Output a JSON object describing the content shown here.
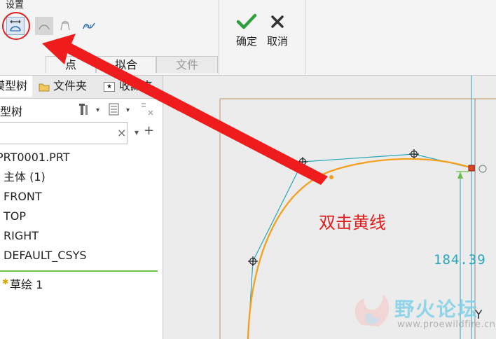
{
  "ribbon": {
    "settings_group_title": "设置",
    "ok_label": "确定",
    "cancel_label": "取消",
    "tabs": [
      {
        "label": "点",
        "active": true
      },
      {
        "label": "拟合",
        "active": true
      },
      {
        "label": "文件",
        "active": false
      }
    ]
  },
  "left_panel": {
    "nav_tabs": [
      "模型树",
      "文件夹",
      "收藏夹"
    ],
    "panel_title": "模型树",
    "search_placeholder": "",
    "search_clear": "×",
    "add_symbol": "+",
    "tree": {
      "root": "PRT0001.PRT",
      "items": [
        "主体 (1)",
        "FRONT",
        "TOP",
        "RIGHT",
        "DEFAULT_CSYS"
      ],
      "sketch_item": "草绘 1"
    }
  },
  "canvas": {
    "annotation": "双击黄线",
    "dimension_value": "184.39",
    "axis_label": "Y",
    "watermark_cn": "野火论坛",
    "watermark_url": "www.proewildfire.cn"
  },
  "colors": {
    "curve": "#f5a01c",
    "construction": "#2aa6b8",
    "arrow": "#ee1c1c",
    "annotation": "#e31a1a",
    "checkmark": "#2e9e3e"
  }
}
